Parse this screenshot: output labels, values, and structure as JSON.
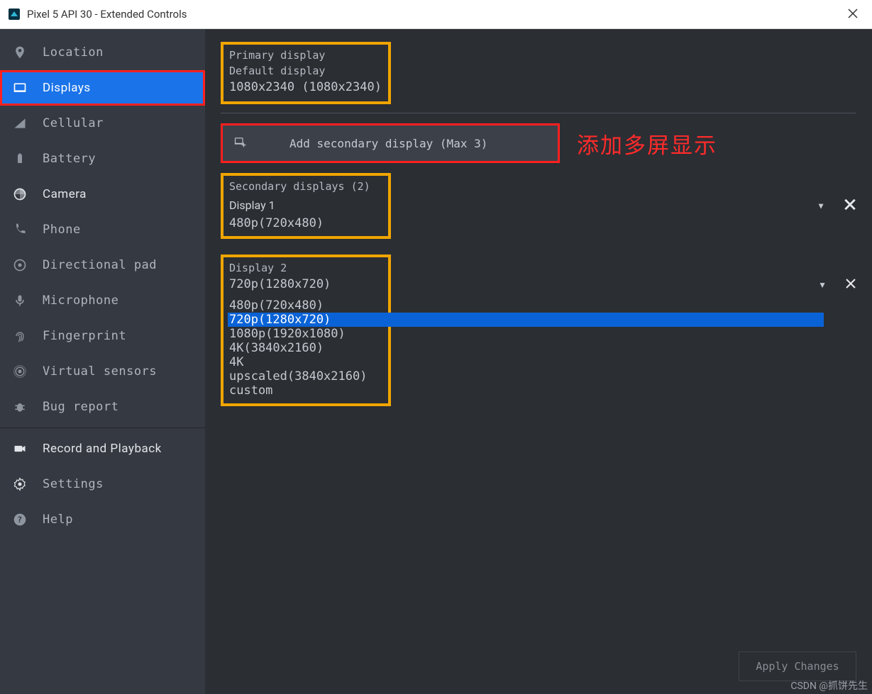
{
  "window": {
    "title": "Pixel 5 API 30 - Extended Controls"
  },
  "sidebar": {
    "items": [
      {
        "label": "Location"
      },
      {
        "label": "Displays"
      },
      {
        "label": "Cellular"
      },
      {
        "label": "Battery"
      },
      {
        "label": "Camera"
      },
      {
        "label": "Phone"
      },
      {
        "label": "Directional pad"
      },
      {
        "label": "Microphone"
      },
      {
        "label": "Fingerprint"
      },
      {
        "label": "Virtual sensors"
      },
      {
        "label": "Bug report"
      },
      {
        "label": "Record and Playback"
      },
      {
        "label": "Settings"
      },
      {
        "label": "Help"
      }
    ]
  },
  "displays": {
    "primary": {
      "title": "Primary display",
      "subtitle": "Default display",
      "resolution": "1080x2340 (1080x2340)"
    },
    "add_button_label": "Add secondary display (Max 3)",
    "annotation": "添加多屏显示",
    "secondary_header": "Secondary displays (2)",
    "display1": {
      "name": "Display 1",
      "resolution": "480p(720x480)"
    },
    "display2": {
      "name": "Display 2",
      "selected": "720p(1280x720)",
      "options": [
        "480p(720x480)",
        "720p(1280x720)",
        "1080p(1920x1080)",
        "4K(3840x2160)",
        "4K upscaled(3840x2160)",
        "custom"
      ]
    },
    "apply_label": "Apply Changes"
  },
  "watermark": "CSDN @抓饼先生"
}
